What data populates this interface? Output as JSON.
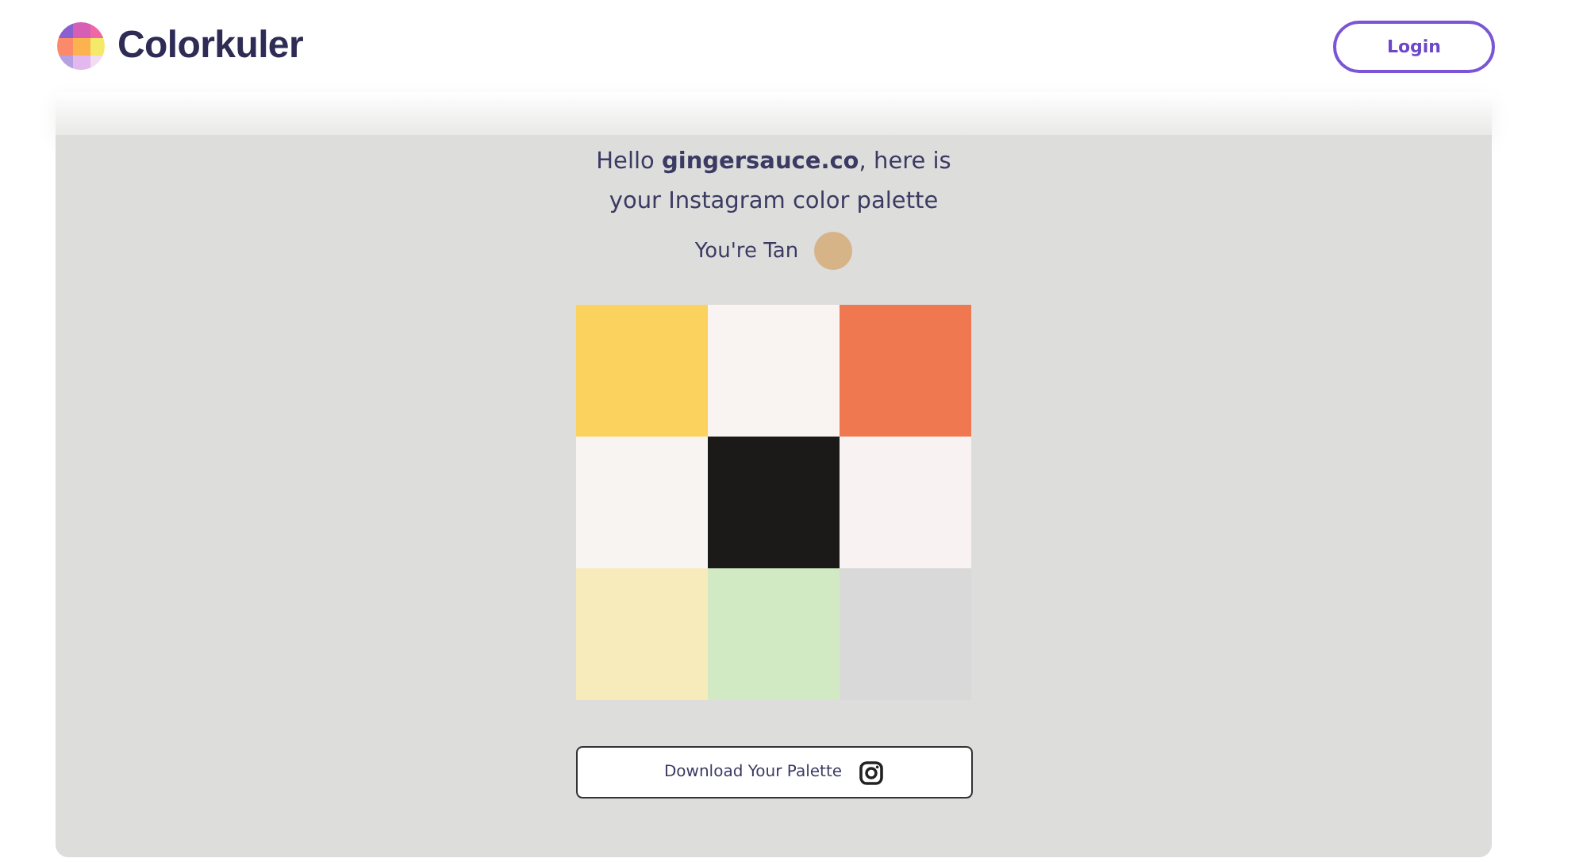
{
  "header": {
    "brand": "Colorkuler",
    "login_button": "Login"
  },
  "greeting": {
    "text": "Hello **gingersauce.co**, here is your Instagram color palette"
  },
  "tone": {
    "label": "You're Tan",
    "color": "#d6b488"
  },
  "palette": [
    {
      "color": "#fbd25e"
    },
    {
      "color": "#f9f3f1"
    },
    {
      "color": "#f07851"
    },
    {
      "color": "#f8f4f2"
    },
    {
      "color": "#1b1a19"
    },
    {
      "color": "#f8f3f2"
    },
    {
      "color": "#f7eabb"
    },
    {
      "color": "#d2eac3"
    },
    {
      "color": "#d8d9d8"
    }
  ],
  "download_button": "Download Your Palette"
}
